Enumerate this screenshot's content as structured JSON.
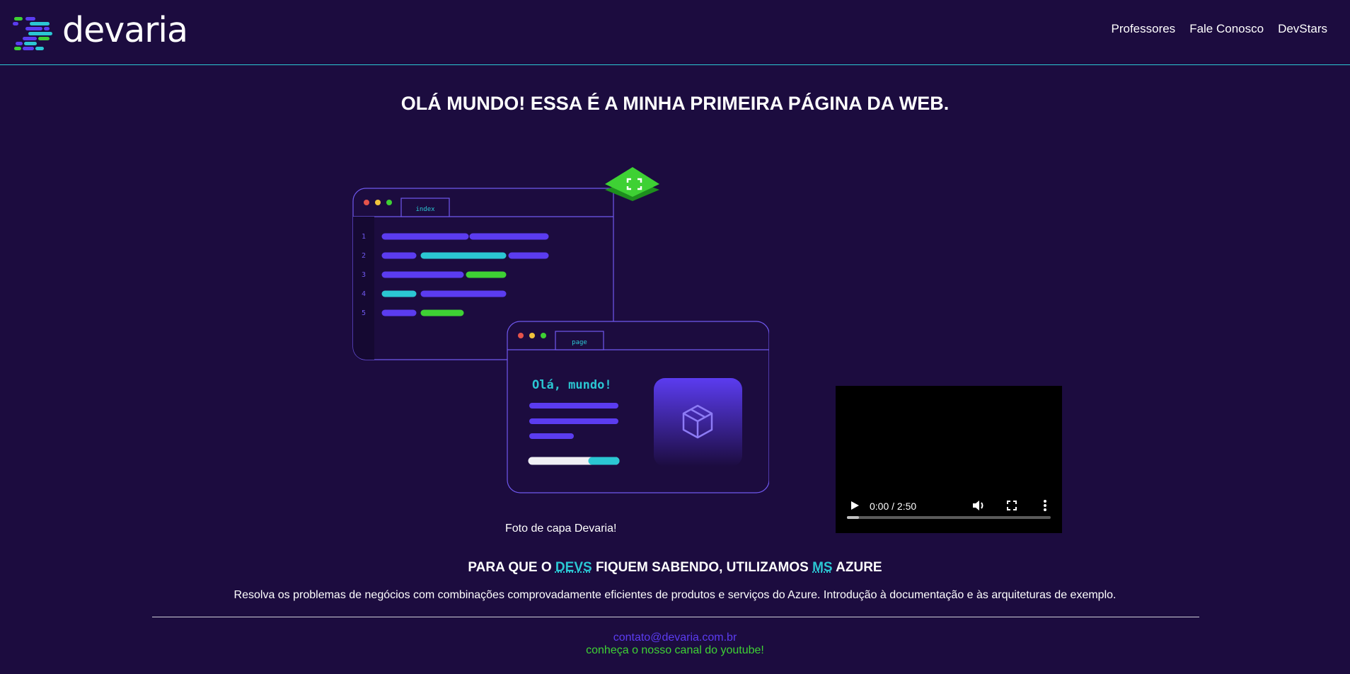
{
  "header": {
    "logo_text": "devaria",
    "nav": [
      "Professores",
      "Fale Conosco",
      "DevStars"
    ]
  },
  "main": {
    "title": "OLÁ MUNDO! ESSA É A MINHA PRIMEIRA PÁGINA DA WEB.",
    "cover": {
      "editor_tab": "index",
      "line_numbers": [
        "1",
        "2",
        "3",
        "4",
        "5"
      ],
      "page_tab": "page",
      "page_heading": "Olá, mundo!",
      "caption": "Foto de capa Devaria!"
    },
    "video": {
      "time": "0:00 / 2:50",
      "progress": 0.06
    },
    "subtitle": {
      "part1": "PARA QUE O",
      "abbr1": "DEVS",
      "part2": "FIQUEM SABENDO, UTILIZAMOS",
      "abbr2": "MS",
      "part3": "AZURE"
    },
    "description": "Resolva os problemas de negócios com combinações comprovadamente eficientes de produtos e serviços do Azure. Introdução à documentação e às arquiteturas de exemplo."
  },
  "footer": {
    "email": "contato@devaria.com.br",
    "youtube": "conheça o nosso canal do youtube!"
  },
  "colors": {
    "background": "#1c0c3f",
    "purple": "#5b3cf0",
    "cyan": "#2bc7d3",
    "green": "#3ed134"
  }
}
